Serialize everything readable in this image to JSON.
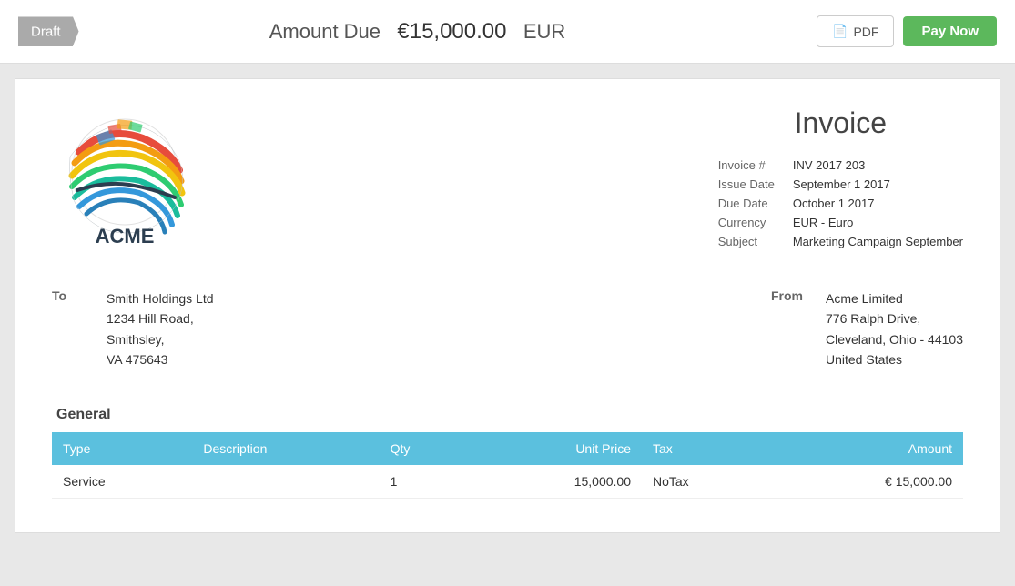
{
  "topbar": {
    "draft_label": "Draft",
    "amount_due_label": "Amount Due",
    "amount_value": "€15,000.00",
    "currency": "EUR",
    "pdf_label": "PDF",
    "pay_now_label": "Pay Now"
  },
  "invoice": {
    "title": "Invoice",
    "details": {
      "invoice_num_label": "Invoice #",
      "invoice_num_value": "INV 2017 203",
      "issue_date_label": "Issue Date",
      "issue_date_value": "September 1 2017",
      "due_date_label": "Due Date",
      "due_date_value": "October 1 2017",
      "currency_label": "Currency",
      "currency_value": "EUR - Euro",
      "subject_label": "Subject",
      "subject_value": "Marketing Campaign September"
    },
    "to_label": "To",
    "to_name": "Smith Holdings Ltd",
    "to_address_line1": "1234 Hill Road,",
    "to_address_line2": "Smithsley,",
    "to_address_line3": "VA 475643",
    "from_label": "From",
    "from_name": "Acme Limited",
    "from_address_line1": "776 Ralph Drive,",
    "from_address_line2": "Cleveland, Ohio - 44103",
    "from_address_line3": "United States",
    "section_title": "General",
    "table": {
      "columns": [
        "Type",
        "Description",
        "Qty",
        "Unit Price",
        "Tax",
        "Amount"
      ],
      "rows": [
        {
          "type": "Service",
          "description": "",
          "qty": "1",
          "unit_price": "15,000.00",
          "tax": "NoTax",
          "amount": "€ 15,000.00"
        }
      ]
    }
  }
}
